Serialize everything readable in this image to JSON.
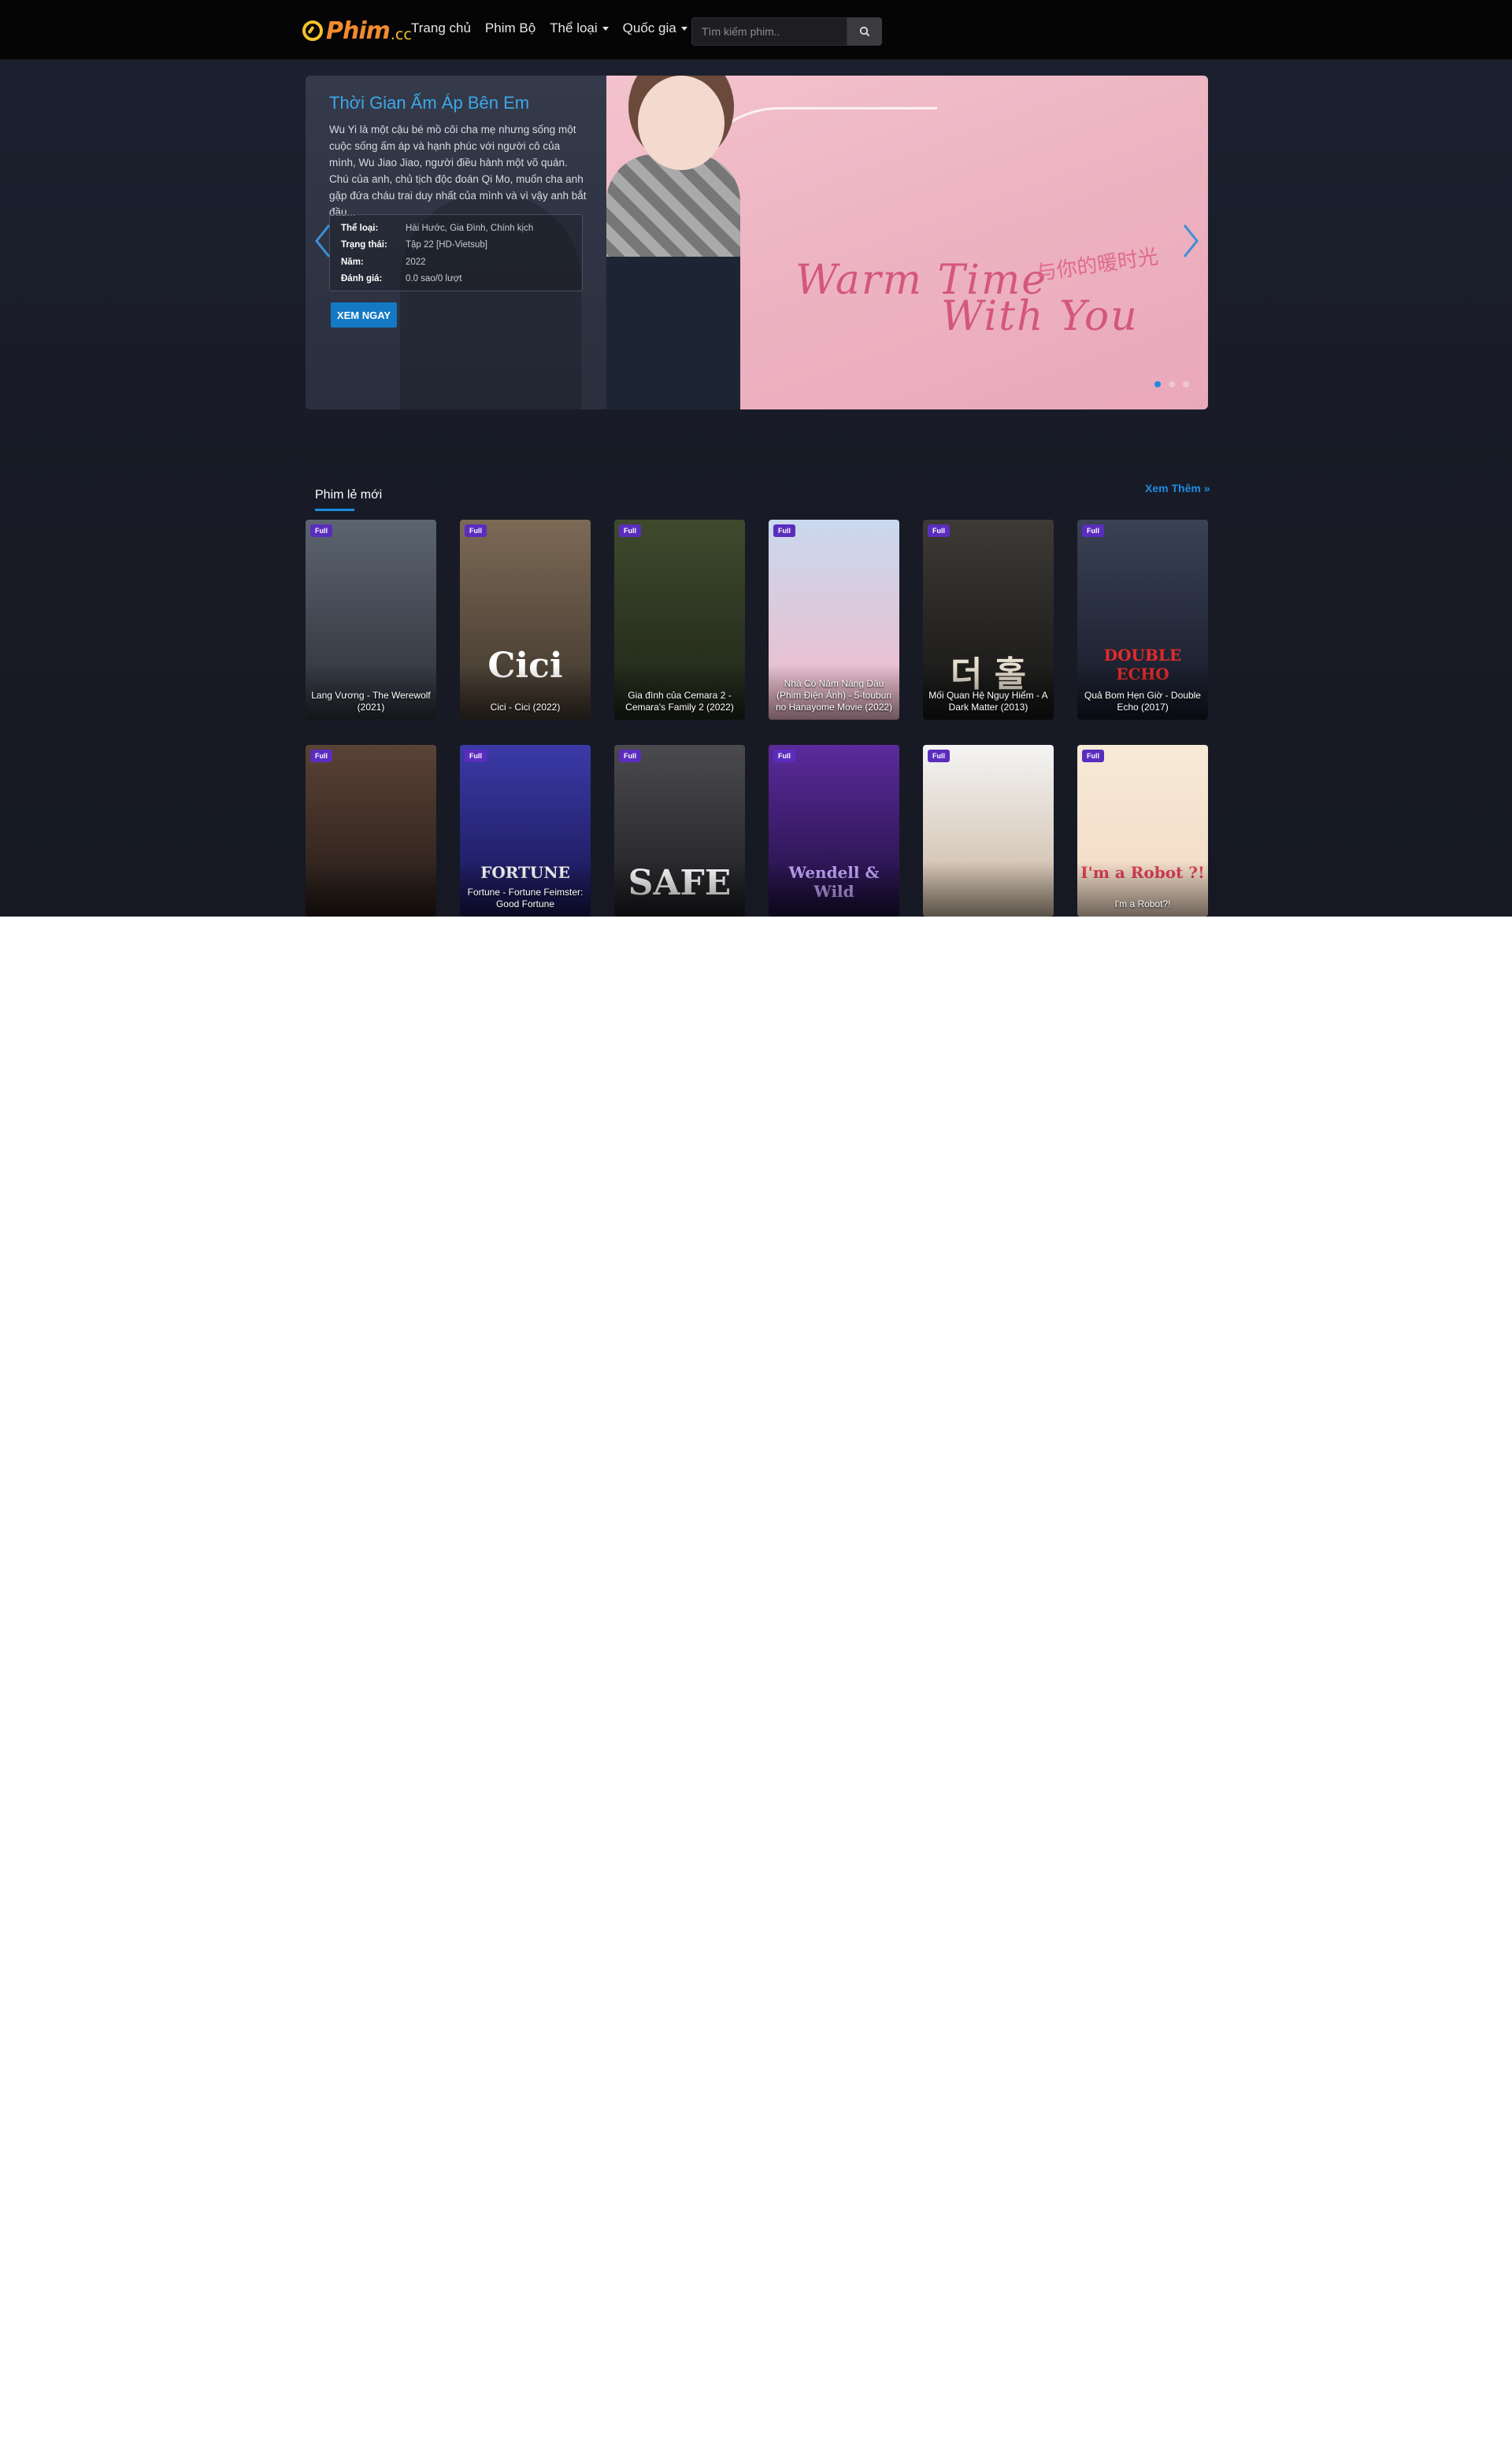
{
  "header": {
    "logo_text": "Phim",
    "logo_tld": ".cc",
    "nav": [
      {
        "label": "Trang chủ",
        "has_dropdown": false
      },
      {
        "label": "Phim Bộ",
        "has_dropdown": false
      },
      {
        "label": "Thể loại",
        "has_dropdown": true
      },
      {
        "label": "Quốc gia",
        "has_dropdown": true
      }
    ],
    "search_placeholder": "Tìm kiếm phim..",
    "search_icon": "search-icon"
  },
  "hero": {
    "title": "Thời Gian Ấm Áp Bên Em",
    "description": "Wu Yi là một cậu bé mồ côi cha mẹ nhưng sống một cuộc sống ấm áp và hạnh phúc với người cô của mình, Wu Jiao Jiao, người điều hành một võ quán. Chú của anh, chủ tịch độc đoán Qi Mo, muốn cha anh gặp đứa cháu trai duy nhất của mình và vì vậy anh bắt đầu...",
    "info": [
      {
        "key": "Thể loại:",
        "value": "Hài Hước, Gia Đình, Chính kịch"
      },
      {
        "key": "Trạng thái:",
        "value": "Tập 22 [HD-Vietsub]"
      },
      {
        "key": "Năm:",
        "value": "2022"
      },
      {
        "key": "Đánh giá:",
        "value": "0.0 sao/0 lượt"
      }
    ],
    "button": "XEM NGAY",
    "poster_text_1": "Warm Time",
    "poster_text_2": "With You",
    "poster_text_cn": "与你的暖时光",
    "slides": 3,
    "active_slide": 0
  },
  "section": {
    "title": "Phim lẻ mới",
    "see_more": "Xem Thêm »",
    "badge": "Full",
    "movies_row1": [
      {
        "title": "Lang Vương - The Werewolf (2021)",
        "poster_text": "",
        "bg": [
          "#5c6470",
          "#2b2f37"
        ],
        "accent": "#c0262a"
      },
      {
        "title": "Cici - Cici (2022)",
        "poster_text": "Cici",
        "bg": [
          "#7c6a56",
          "#3d342b"
        ],
        "accent": "#ffffff"
      },
      {
        "title": "Gia đình của Cemara 2 - Cemara's Family 2 (2022)",
        "poster_text": "",
        "bg": [
          "#3f4a2d",
          "#1d2417"
        ],
        "accent": "#e8c548"
      },
      {
        "title": "Nhà Có Năm Nàng Dâu (Phim Điện Ảnh) - 5-toubun no Hanayome Movie (2022)",
        "poster_text": "",
        "bg": [
          "#c9d8ee",
          "#f2b9c8"
        ],
        "accent": "#e85f8a"
      },
      {
        "title": "Mối Quan Hệ Nguy Hiểm - A Dark Matter (2013)",
        "poster_text": "더 홀",
        "bg": [
          "#3d3a36",
          "#141414"
        ],
        "accent": "#e8e0d0"
      },
      {
        "title": "Quả Bom Hẹn Giờ - Double Echo (2017)",
        "poster_text": "DOUBLE ECHO",
        "bg": [
          "#3a4255",
          "#141826"
        ],
        "accent": "#e42b2b"
      }
    ],
    "movies_row2": [
      {
        "title": "",
        "poster_text": "",
        "bg": [
          "#5a4236",
          "#231a16"
        ],
        "accent": "#c0262a"
      },
      {
        "title": "Fortune - Fortune Feimster: Good Fortune",
        "poster_text": "FORTUNE",
        "bg": [
          "#3b3aa8",
          "#16154d"
        ],
        "accent": "#ffffff"
      },
      {
        "title": "",
        "poster_text": "SAFE",
        "bg": [
          "#4b4a4e",
          "#1c1c20"
        ],
        "accent": "#ffffff"
      },
      {
        "title": "",
        "poster_text": "Wendell & Wild",
        "bg": [
          "#5c2a9c",
          "#1b0f3a"
        ],
        "accent": "#c7a7ff"
      },
      {
        "title": "",
        "poster_text": "",
        "bg": [
          "#f4f4f4",
          "#c9b59e"
        ],
        "accent": "#222222"
      },
      {
        "title": "I'm a Robot?!",
        "poster_text": "I'm a Robot ?!",
        "bg": [
          "#f6ead6",
          "#f2d9c4"
        ],
        "accent": "#e2415a"
      }
    ]
  }
}
